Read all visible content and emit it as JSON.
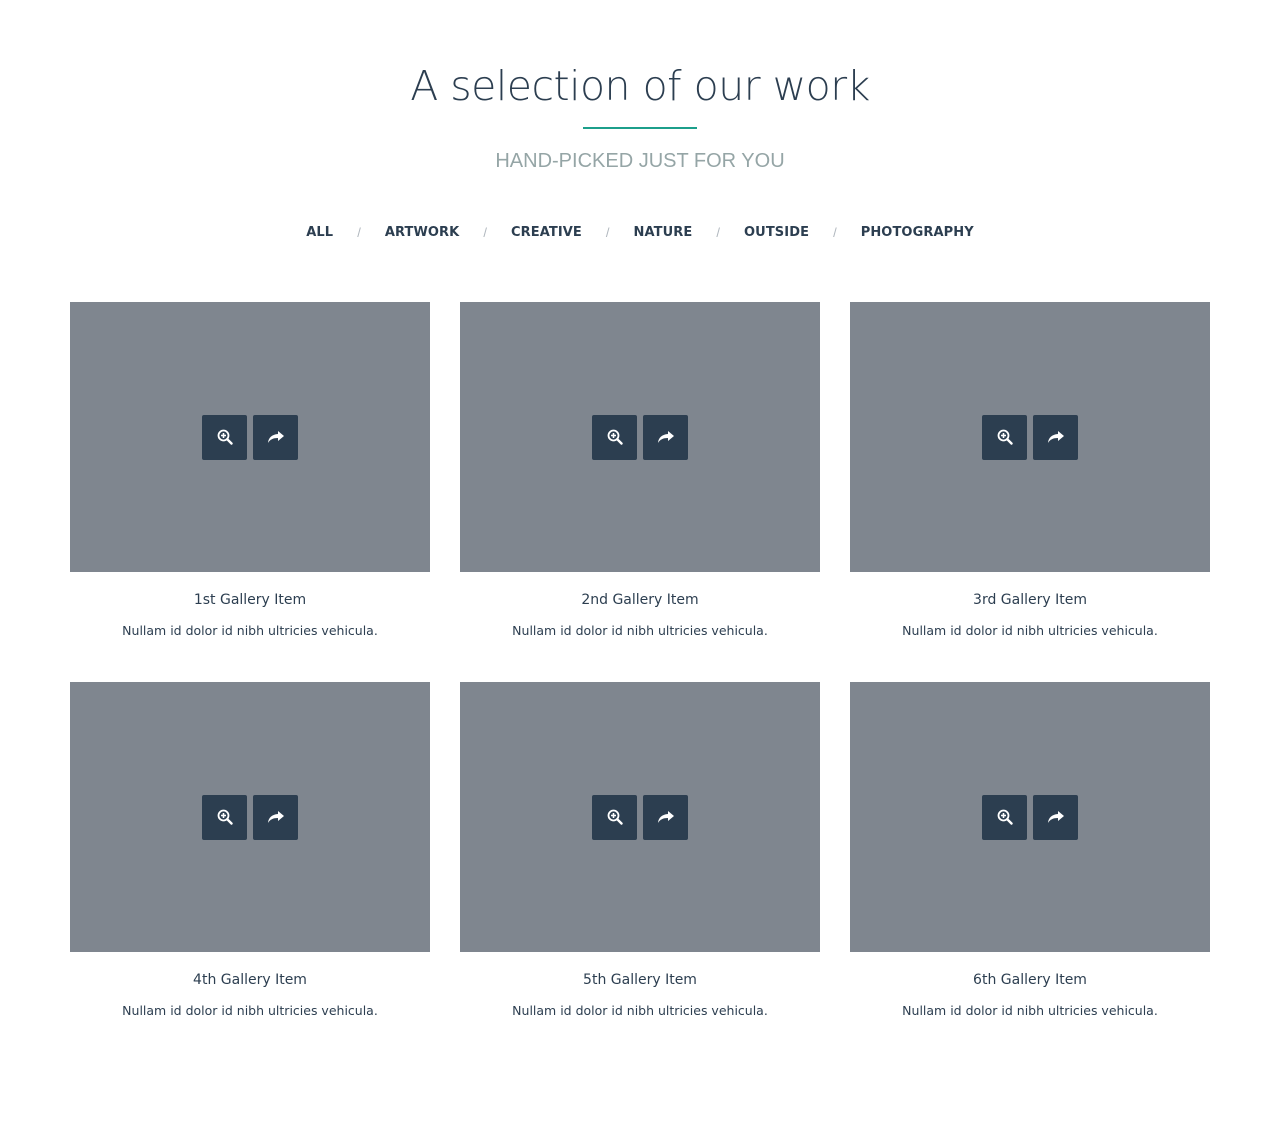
{
  "header": {
    "title": "A selection of our work",
    "subtitle": "HAND-PICKED JUST FOR YOU"
  },
  "filters": {
    "separator": "/",
    "items": [
      "ALL",
      "ARTWORK",
      "CREATIVE",
      "NATURE",
      "OUTSIDE",
      "PHOTOGRAPHY"
    ]
  },
  "gallery": {
    "items": [
      {
        "title": "1st Gallery Item",
        "description": "Nullam id dolor id nibh ultricies vehicula.",
        "zoom_icon": "zoom-in-icon",
        "share_icon": "share-icon"
      },
      {
        "title": "2nd Gallery Item",
        "description": "Nullam id dolor id nibh ultricies vehicula.",
        "zoom_icon": "zoom-in-icon",
        "share_icon": "share-icon"
      },
      {
        "title": "3rd Gallery Item",
        "description": "Nullam id dolor id nibh ultricies vehicula.",
        "zoom_icon": "zoom-in-icon",
        "share_icon": "share-icon"
      },
      {
        "title": "4th Gallery Item",
        "description": "Nullam id dolor id nibh ultricies vehicula.",
        "zoom_icon": "zoom-in-icon",
        "share_icon": "share-icon"
      },
      {
        "title": "5th Gallery Item",
        "description": "Nullam id dolor id nibh ultricies vehicula.",
        "zoom_icon": "zoom-in-icon",
        "share_icon": "share-icon"
      },
      {
        "title": "6th Gallery Item",
        "description": "Nullam id dolor id nibh ultricies vehicula.",
        "zoom_icon": "zoom-in-icon",
        "share_icon": "share-icon"
      }
    ]
  },
  "colors": {
    "accent": "#1c9f8b",
    "dark": "#2c3e50",
    "placeholder": "#7f868f",
    "subtitle": "#95a5a6"
  }
}
